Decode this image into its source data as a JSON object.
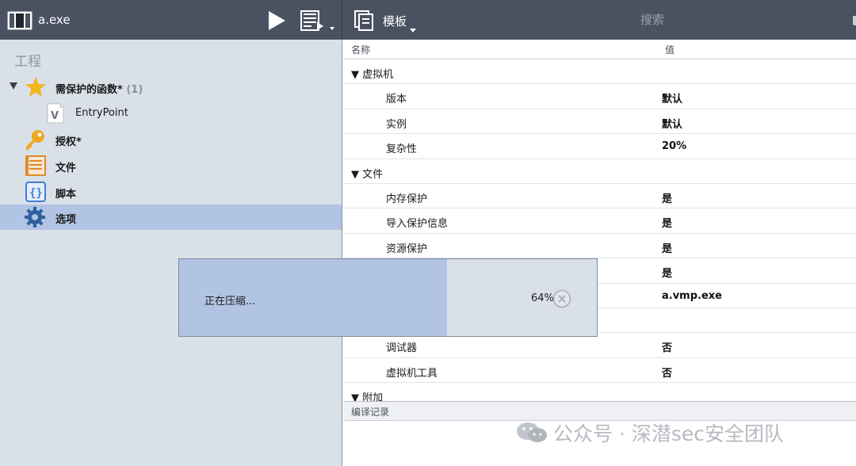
{
  "toolbar": {
    "app_title": "a.exe",
    "template_label": "模板",
    "search_placeholder": "搜索"
  },
  "project": {
    "section_title": "工程",
    "items": [
      {
        "label": "需保护的函数*",
        "count": "(1)",
        "icon": "star-icon",
        "expanded": true
      },
      {
        "label": "EntryPoint",
        "icon": "function-v-icon"
      },
      {
        "label": "授权*",
        "icon": "key-icon"
      },
      {
        "label": "文件",
        "icon": "file-list-icon"
      },
      {
        "label": "脚本",
        "icon": "script-braces-icon"
      },
      {
        "label": "选项",
        "icon": "gear-icon",
        "selected": true
      }
    ]
  },
  "properties": {
    "header_name": "名称",
    "header_value": "值",
    "rows": [
      {
        "type": "category",
        "label": "虚拟机"
      },
      {
        "type": "property",
        "name": "版本",
        "value": "默认"
      },
      {
        "type": "property",
        "name": "实例",
        "value": "默认"
      },
      {
        "type": "property",
        "name": "复杂性",
        "value": "20%"
      },
      {
        "type": "category",
        "label": "文件"
      },
      {
        "type": "property",
        "name": "内存保护",
        "value": "是"
      },
      {
        "type": "property",
        "name": "导入保护信息",
        "value": "是"
      },
      {
        "type": "property",
        "name": "资源保护",
        "value": "是"
      },
      {
        "type": "property",
        "name": "",
        "value": "是"
      },
      {
        "type": "property",
        "name": "",
        "value": "a.vmp.exe"
      },
      {
        "type": "property",
        "name": "",
        "value": ""
      },
      {
        "type": "property",
        "name": "调试器",
        "value": "否"
      },
      {
        "type": "property",
        "name": "虚拟机工具",
        "value": "否"
      },
      {
        "type": "category",
        "label": "附加"
      }
    ]
  },
  "log": {
    "header": "编译记录"
  },
  "progress": {
    "text": "正在压缩...",
    "percent_label": "64%",
    "fraction": 0.64
  },
  "watermark": {
    "text": "公众号 · 深潜sec安全团队"
  },
  "colors": {
    "toolbar_bg": "#4a5262",
    "pane_bg": "#d9e0e8",
    "selection": "#b1c4e3",
    "star": "#f2b51b",
    "key": "#f0a81f",
    "file_icon": "#e08a2a",
    "script_icon": "#3f7fd4",
    "gear": "#2f5f9c"
  }
}
